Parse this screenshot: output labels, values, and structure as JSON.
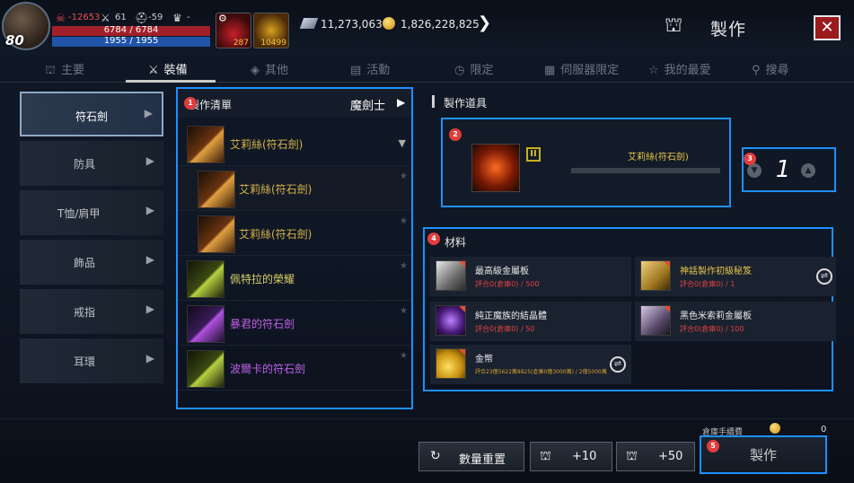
{
  "player": {
    "level": "80",
    "stat1": "-12653",
    "stat2": "61",
    "stat3": "-59",
    "hp": "6784 / 6784",
    "mp": "1955 / 1955",
    "slot1_count": "287",
    "slot2_count": "10499"
  },
  "currency": {
    "gems": "11,273,063",
    "gold": "1,826,228,825"
  },
  "header": {
    "title": "製作",
    "close": "✕"
  },
  "tabs": [
    {
      "label": "主要",
      "icon": "anvil-icon"
    },
    {
      "label": "裝備",
      "icon": "crossed-swords-icon"
    },
    {
      "label": "其他",
      "icon": "cube-icon"
    },
    {
      "label": "活動",
      "icon": "gift-icon"
    },
    {
      "label": "限定",
      "icon": "timer-icon"
    },
    {
      "label": "伺服器限定",
      "icon": "server-icon"
    },
    {
      "label": "我的最愛",
      "icon": "star-icon"
    },
    {
      "label": "搜尋",
      "icon": "search-icon"
    }
  ],
  "categories": [
    {
      "label": "符石劍"
    },
    {
      "label": "防具"
    },
    {
      "label": "T恤/肩甲"
    },
    {
      "label": "飾品"
    },
    {
      "label": "戒指"
    },
    {
      "label": "耳環"
    }
  ],
  "craft_list": {
    "title": "製作清單",
    "class_filter": "魔劍士",
    "items": [
      {
        "name": "艾莉絲(符石劍)"
      },
      {
        "name": "艾莉絲(符石劍)"
      },
      {
        "name": "艾莉絲(符石劍)"
      },
      {
        "name": "佩特拉的榮耀"
      },
      {
        "name": "暴君的符石劍"
      },
      {
        "name": "波爾卡的符石劍"
      }
    ]
  },
  "tool": {
    "section_title": "製作道具",
    "grade": "II",
    "name": "艾莉絲(符石劍)"
  },
  "quantity": {
    "value": "1"
  },
  "materials": {
    "section_title": "材料",
    "items": [
      {
        "name": "最高級金屬板",
        "qty": "評合0(倉庫0) / 500"
      },
      {
        "name": "神話製作初級秘笈",
        "qty": "評合0(倉庫0) / 1"
      },
      {
        "name": "純正魔族的結晶體",
        "qty": "評合0(倉庫0) / 50"
      },
      {
        "name": "黑色米索莉金屬板",
        "qty": "評合0(倉庫0) / 100"
      },
      {
        "name": "金幣",
        "qty": "評合23億5622萬8825(倉庫0億3000萬) / 2億5000萬"
      }
    ]
  },
  "footer": {
    "fee_label": "倉庫手續費",
    "fee_value": "0",
    "reset_label": "數量重置",
    "plus10_label": "+10",
    "plus50_label": "+50",
    "craft_label": "製作"
  },
  "badges": [
    "1",
    "2",
    "3",
    "4",
    "5"
  ]
}
